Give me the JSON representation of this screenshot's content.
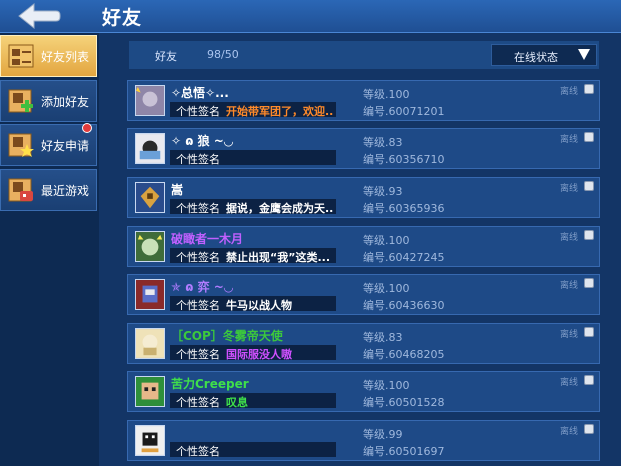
{
  "header": {
    "title": "好友"
  },
  "sidebar": {
    "items": [
      {
        "label": "好友列表"
      },
      {
        "label": "添加好友"
      },
      {
        "label": "好友申请"
      },
      {
        "label": "最近游戏"
      }
    ]
  },
  "filter": {
    "label": "好友",
    "count": "98/50",
    "status": "在线状态"
  },
  "sig_label": "个性签名",
  "online_label": "离线",
  "friends": [
    {
      "name": "✧总悟✧...",
      "name_color": "#ffffff",
      "sig": "开始带军团了，欢迎...",
      "sig_color": "#ff8a2a",
      "level": "等级.100",
      "uid": "编号.60071201"
    },
    {
      "name": "✧ ɷ 狼 ~◡",
      "name_color": "#ffffff",
      "sig": "",
      "sig_color": "#ffffff",
      "level": "等级.83",
      "uid": "编号.60356710"
    },
    {
      "name": "嵩",
      "name_color": "#ffffff",
      "sig": "据说，金鹰会成为天...",
      "sig_color": "#ffffff",
      "level": "等级.93",
      "uid": "编号.60365936"
    },
    {
      "name": "破瞰者一木月",
      "name_color": "#c060ff",
      "sig": "禁止出现“我”这类...",
      "sig_color": "#ffffff",
      "level": "等级.100",
      "uid": "编号.60427245"
    },
    {
      "name": "✯ ɷ 弈 ~◡",
      "name_color": "#b07cff",
      "sig": "牛马以战人物",
      "sig_color": "#ffffff",
      "level": "等级.100",
      "uid": "编号.60436630"
    },
    {
      "name": "［COP］冬雾帝天使",
      "name_color": "#3cc93c",
      "sig": "国际服没人嗷",
      "sig_color": "#d050ff",
      "level": "等级.83",
      "uid": "编号.60468205"
    },
    {
      "name": "苦力Creeper",
      "name_color": "#3fe04a",
      "sig": "叹息",
      "sig_color": "#3fe04a",
      "level": "等级.100",
      "uid": "编号.60501528"
    },
    {
      "name": "",
      "name_color": "#ffffff",
      "sig": "",
      "sig_color": "#ffffff",
      "level": "等级.99",
      "uid": "编号.60501697"
    }
  ]
}
